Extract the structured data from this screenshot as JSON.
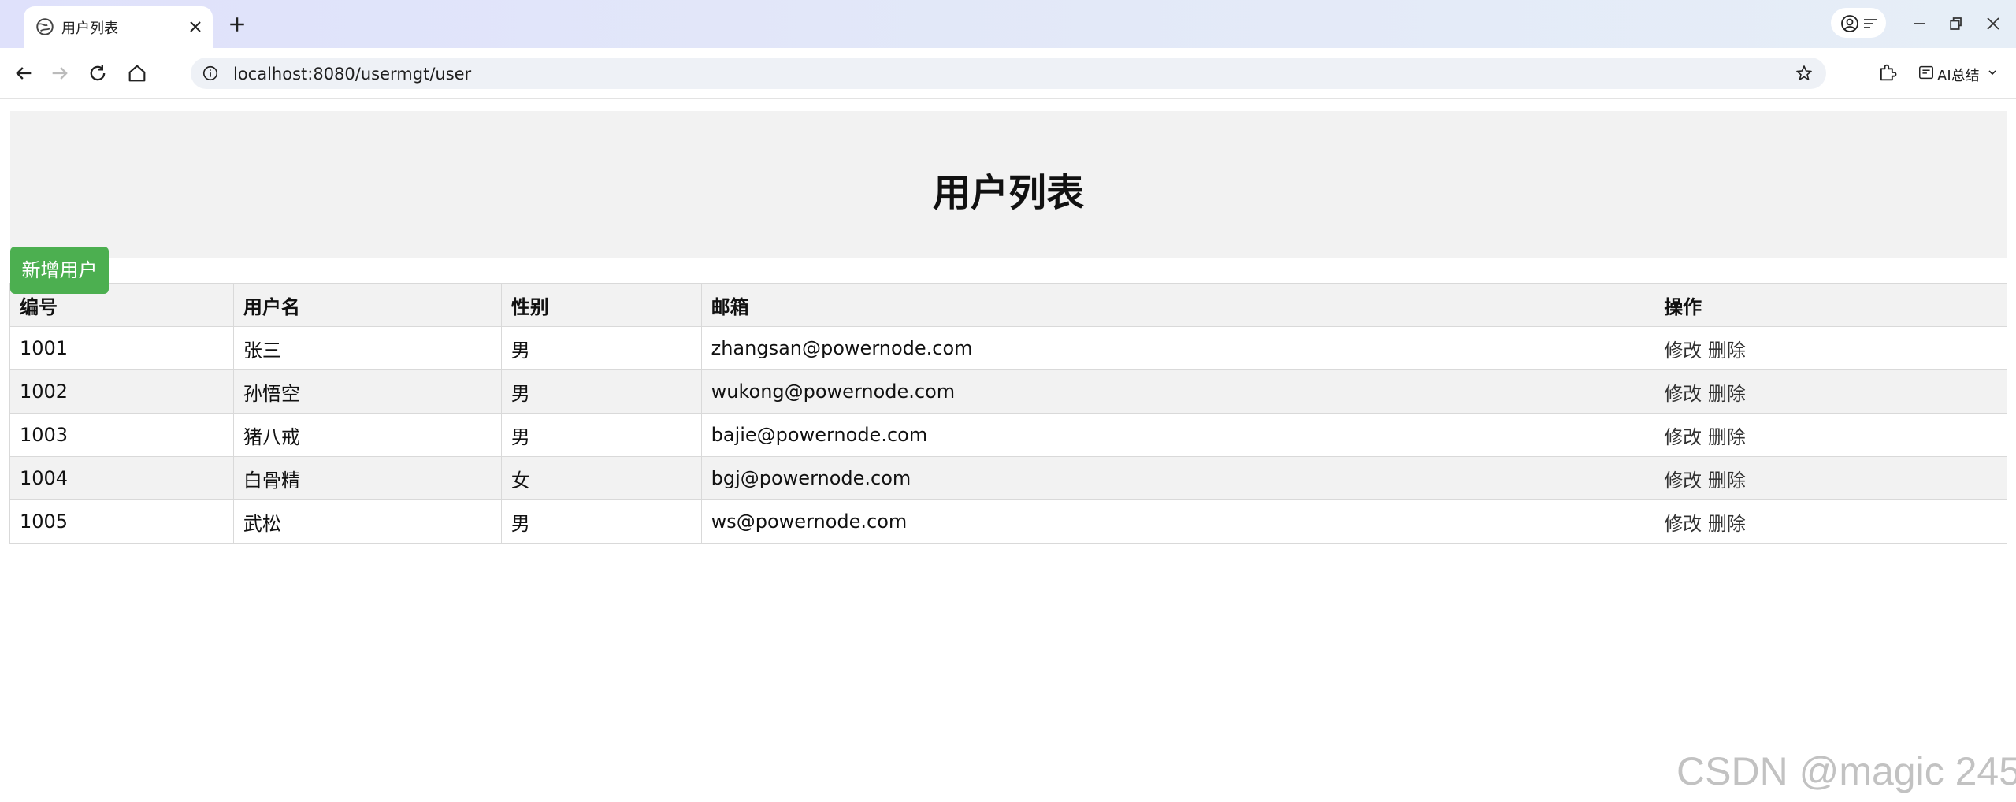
{
  "browser": {
    "tab_title": "用户列表",
    "url": "localhost:8080/usermgt/user",
    "ai_label": "AI总结"
  },
  "page": {
    "title": "用户列表",
    "add_button": "新增用户"
  },
  "table": {
    "headers": [
      "编号",
      "用户名",
      "性别",
      "邮箱",
      "操作"
    ],
    "rows": [
      {
        "id": "1001",
        "name": "张三",
        "gender": "男",
        "email": "zhangsan@powernode.com"
      },
      {
        "id": "1002",
        "name": "孙悟空",
        "gender": "男",
        "email": "wukong@powernode.com"
      },
      {
        "id": "1003",
        "name": "猪八戒",
        "gender": "男",
        "email": "bajie@powernode.com"
      },
      {
        "id": "1004",
        "name": "白骨精",
        "gender": "女",
        "email": "bgj@powernode.com"
      },
      {
        "id": "1005",
        "name": "武松",
        "gender": "男",
        "email": "ws@powernode.com"
      }
    ],
    "edit_label": "修改",
    "delete_label": "删除"
  },
  "watermark": "CSDN @magic 245",
  "icons": {
    "favicon": "globe-icon",
    "tab_close": "close-icon",
    "new_tab": "plus-icon",
    "back": "arrow-left-icon",
    "forward": "arrow-right-icon",
    "reload": "reload-icon",
    "home": "home-icon",
    "site_info": "info-icon",
    "bookmark": "star-icon",
    "extensions": "puzzle-icon",
    "profile": "avatar-icon"
  },
  "colors": {
    "add_button_bg": "#4caf50",
    "header_bg": "#f2f2f2",
    "stripe_bg": "#f2f2f2"
  }
}
